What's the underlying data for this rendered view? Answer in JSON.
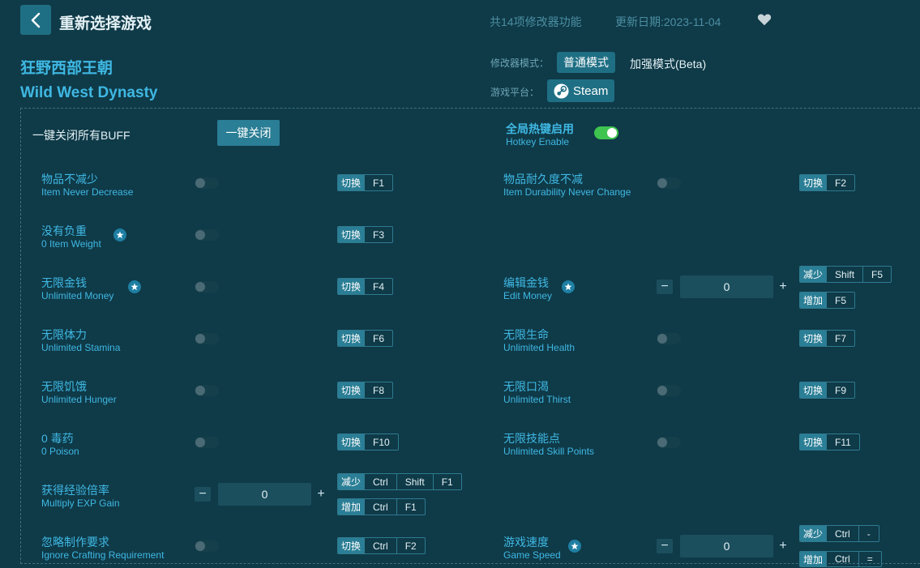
{
  "header": {
    "title": "重新选择游戏",
    "feature_count": "共14项修改器功能",
    "update_date": "更新日期:2023-11-04"
  },
  "game": {
    "name_cn": "狂野西部王朝",
    "name_en": "Wild West Dynasty"
  },
  "mode": {
    "label": "修改器模式：",
    "normal": "普通模式",
    "beta": "加强模式(Beta)"
  },
  "platform": {
    "label": "游戏平台：",
    "name": "Steam"
  },
  "controls": {
    "oneclick_label": "一键关闭所有BUFF",
    "oneclick_button": "一键关闭",
    "hotkey_cn": "全局热键启用",
    "hotkey_en": "Hotkey Enable"
  },
  "labels": {
    "toggle": "切换",
    "decrease": "减少",
    "increase": "增加"
  },
  "features": [
    {
      "cn": "物品不减少",
      "en": "Item Never Decrease",
      "keys": [
        "F1"
      ]
    },
    {
      "cn": "物品耐久度不减",
      "en": "Item Durability Never Change",
      "keys": [
        "F2"
      ]
    },
    {
      "cn": "没有负重",
      "en": "0 Item Weight",
      "keys": [
        "F3"
      ]
    },
    {
      "cn": "无限金钱",
      "en": "Unlimited Money",
      "keys": [
        "F4"
      ]
    },
    {
      "cn": "编辑金钱",
      "en": "Edit Money",
      "value": "0",
      "dec_keys": [
        "Shift",
        "F5"
      ],
      "inc_keys": [
        "F5"
      ]
    },
    {
      "cn": "无限体力",
      "en": "Unlimited Stamina",
      "keys": [
        "F6"
      ]
    },
    {
      "cn": "无限生命",
      "en": "Unlimited Health",
      "keys": [
        "F7"
      ]
    },
    {
      "cn": "无限饥饿",
      "en": "Unlimited Hunger",
      "keys": [
        "F8"
      ]
    },
    {
      "cn": "无限口渴",
      "en": "Unlimited Thirst",
      "keys": [
        "F9"
      ]
    },
    {
      "cn": "0 毒药",
      "en": "0 Poison",
      "keys": [
        "F10"
      ]
    },
    {
      "cn": "无限技能点",
      "en": "Unlimited Skill Points",
      "keys": [
        "F11"
      ]
    },
    {
      "cn": "获得经验倍率",
      "en": "Multiply EXP Gain",
      "value": "0",
      "dec_keys": [
        "Ctrl",
        "Shift",
        "F1"
      ],
      "inc_keys": [
        "Ctrl",
        "F1"
      ]
    },
    {
      "cn": "忽略制作要求",
      "en": "Ignore Crafting Requirement",
      "keys": [
        "Ctrl",
        "F2"
      ]
    },
    {
      "cn": "游戏速度",
      "en": "Game Speed",
      "value": "0",
      "dec_keys": [
        "Ctrl",
        "-"
      ],
      "inc_keys": [
        "Ctrl",
        "="
      ]
    }
  ]
}
